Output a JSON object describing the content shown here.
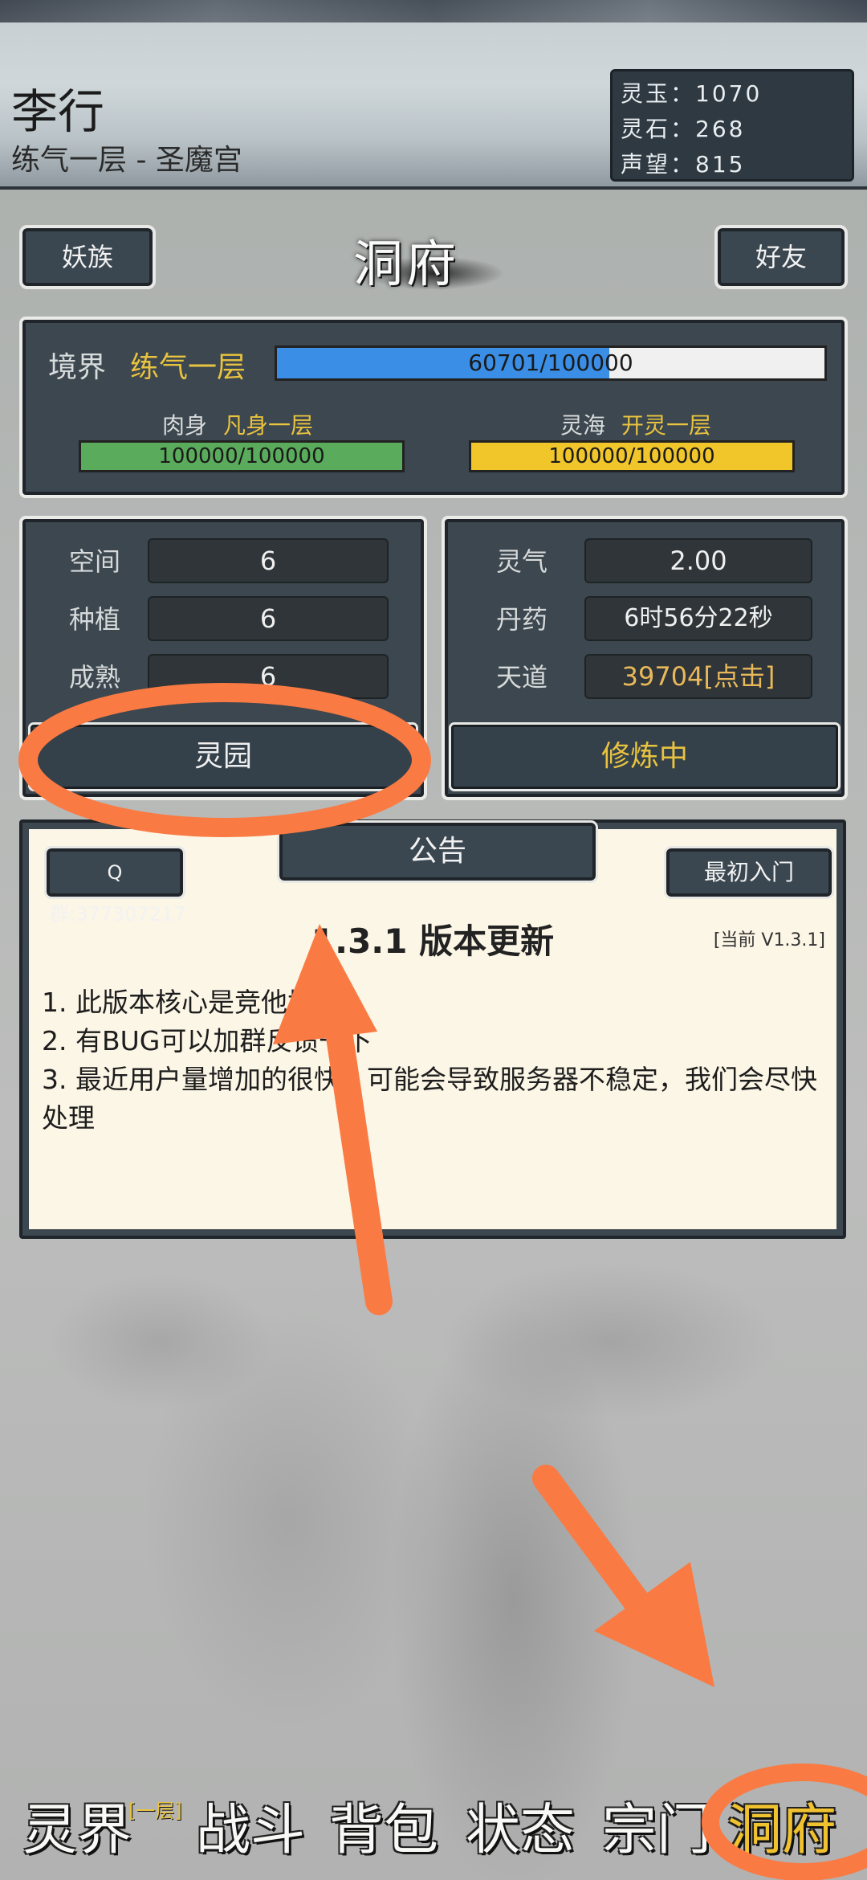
{
  "header": {
    "player_name": "李行",
    "subtitle": "练气一层 - 圣魔宫",
    "resources": [
      {
        "label": "灵玉：",
        "value": "1070"
      },
      {
        "label": "灵石：",
        "value": "268"
      },
      {
        "label": "声望：",
        "value": "815"
      }
    ]
  },
  "top": {
    "left_button": "妖族",
    "title": "洞府",
    "right_button": "好友"
  },
  "realm": {
    "label": "境界",
    "value": "练气一层",
    "progress_text": "60701/100000",
    "progress_fraction": 0.607,
    "body_label": "肉身",
    "body_value": "凡身一层",
    "body_text": "100000/100000",
    "body_fraction": 1.0,
    "sea_label": "灵海",
    "sea_value": "开灵一层",
    "sea_text": "100000/100000",
    "sea_fraction": 1.0
  },
  "garden": {
    "rows": [
      {
        "label": "空间",
        "value": "6"
      },
      {
        "label": "种植",
        "value": "6"
      },
      {
        "label": "成熟",
        "value": "6"
      }
    ],
    "button": "灵园"
  },
  "cultivation": {
    "rows": [
      {
        "label": "灵气",
        "value": "2.00"
      },
      {
        "label": "丹药",
        "value": "6时56分22秒"
      },
      {
        "label": "天道",
        "value": "39704[点击]"
      }
    ],
    "button": "修炼中"
  },
  "notice": {
    "qq_button": "Q群:377307217",
    "tab": "公告",
    "guide_button": "最初入门",
    "heading": "1.3.1 版本更新",
    "version": "[当前 V1.3.1]",
    "lines": [
      "1. 此版本核心是竞他塔",
      "2. 有BUG可以加群反馈一下",
      "3. 最近用户量增加的很快，可能会导致服务器不稳定，我们会尽快处理"
    ]
  },
  "nav": {
    "items": [
      "灵界",
      "战斗",
      "背包",
      "状态",
      "宗门",
      "洞府"
    ],
    "badge": "[一层]"
  },
  "colors": {
    "gold": "#e9c33f",
    "panel": "#3c474f",
    "progress_blue": "#3a8ee6",
    "body_green": "#5aac5c",
    "sea_yellow": "#f0c62a",
    "annotation_orange": "#fa7a43"
  }
}
